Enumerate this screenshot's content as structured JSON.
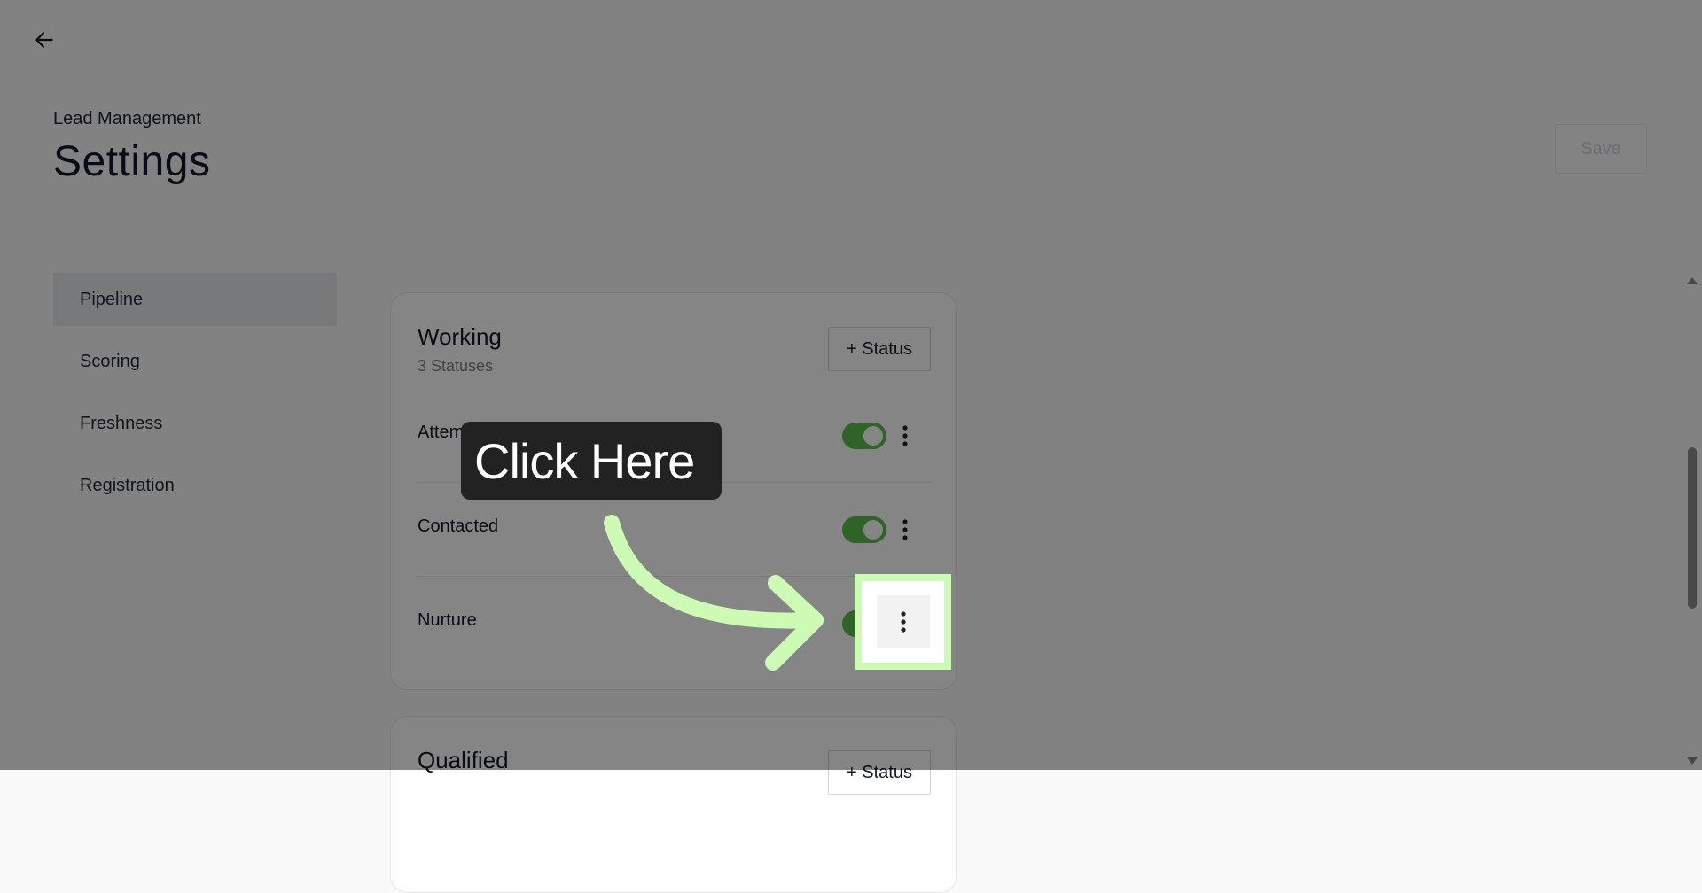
{
  "header": {
    "breadcrumb": "Lead Management",
    "title": "Settings",
    "save_label": "Save"
  },
  "sidebar": {
    "items": [
      {
        "label": "Pipeline",
        "active": true
      },
      {
        "label": "Scoring",
        "active": false
      },
      {
        "label": "Freshness",
        "active": false
      },
      {
        "label": "Registration",
        "active": false
      }
    ]
  },
  "pipeline": {
    "groups": [
      {
        "title": "Working",
        "subtitle": "3 Statuses",
        "add_label": "+ Status",
        "statuses": [
          {
            "label": "Attempting to Contact",
            "enabled": true
          },
          {
            "label": "Contacted",
            "enabled": true
          },
          {
            "label": "Nurture",
            "enabled": true
          }
        ]
      },
      {
        "title": "Qualified",
        "add_label": "+ Status"
      }
    ]
  },
  "overlay": {
    "callout_text": "Click Here",
    "highlight_color": "#cdfbb5"
  },
  "colors": {
    "toggle_on": "#5cbf4e",
    "active_nav": "#e7e8ec"
  }
}
